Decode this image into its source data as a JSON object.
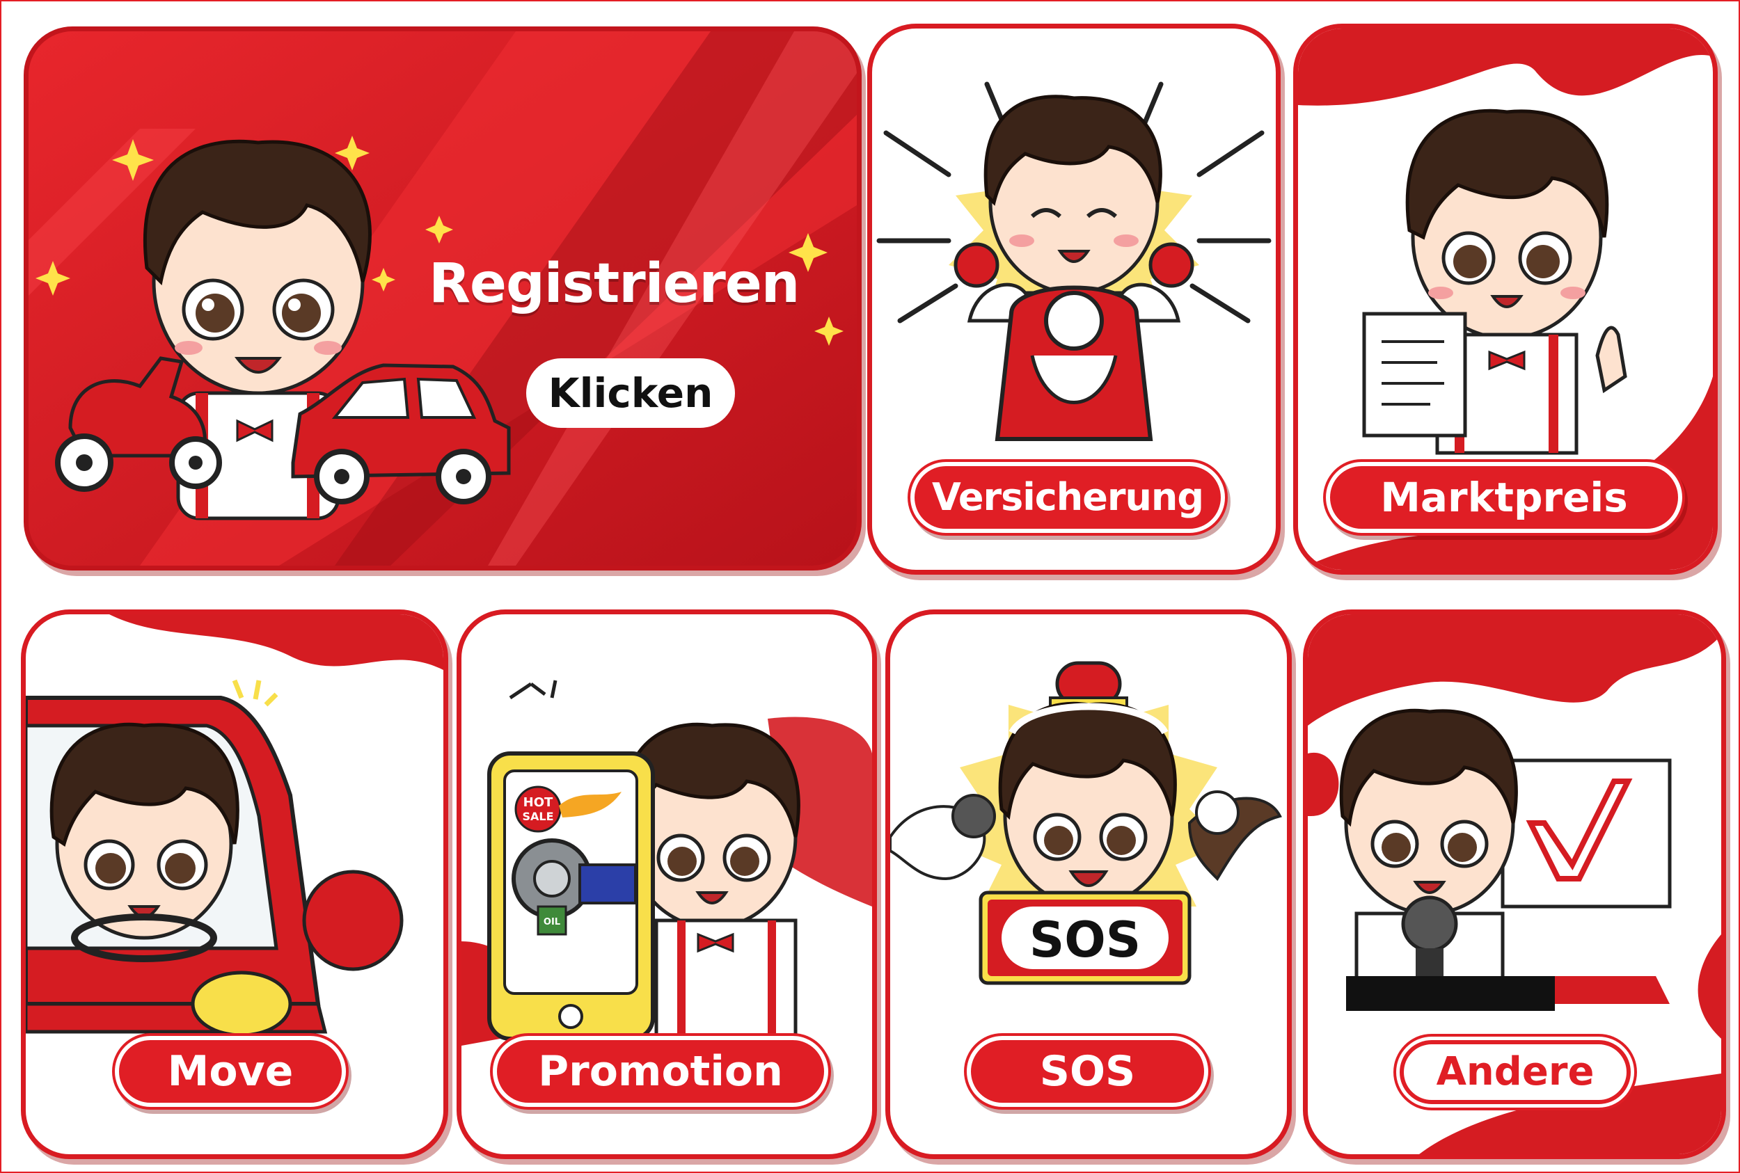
{
  "accent": "#e01e25",
  "dark_red": "#b5121b",
  "hero": {
    "title": "Registrieren",
    "button": "Klicken",
    "icons": [
      "sparkle-icon",
      "scooter-icon",
      "car-icon"
    ]
  },
  "tiles": [
    {
      "id": "versicherung",
      "label": "Versicherung",
      "icon": "scooter-icon"
    },
    {
      "id": "marktpreis",
      "label": "Marktpreis",
      "icon": "document-icon"
    },
    {
      "id": "move",
      "label": "Move",
      "icon": "car-icon"
    },
    {
      "id": "promotion",
      "label": "Promotion",
      "icon": "phone-icon"
    },
    {
      "id": "sos",
      "label": "SOS",
      "icon": "siren-icon",
      "sign": "SOS"
    },
    {
      "id": "andere",
      "label": "Andere",
      "icon": "microphone-icon"
    }
  ],
  "promo_badge": {
    "line1": "HOT",
    "line2": "SALE"
  },
  "oil_label": "OIL"
}
